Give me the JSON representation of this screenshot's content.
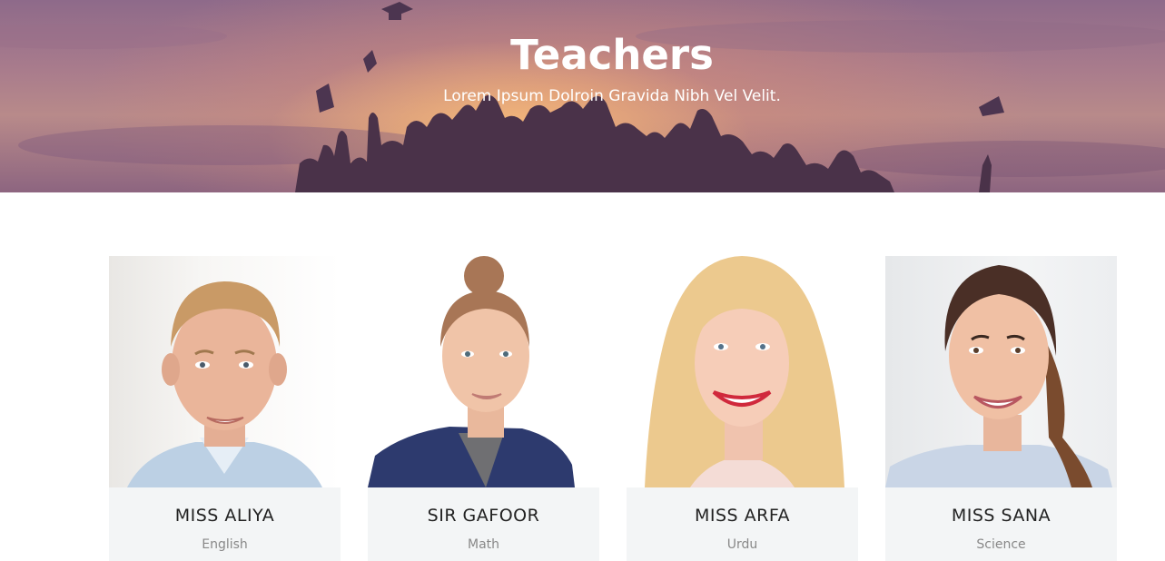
{
  "hero": {
    "title": "Teachers",
    "subtitle": "Lorem Ipsum Dolroin Gravida Nibh Vel Velit."
  },
  "teachers": [
    {
      "name": "MISS ALIYA",
      "subject": "English",
      "photo": "man-portrait"
    },
    {
      "name": "SIR GAFOOR",
      "subject": "Math",
      "photo": "woman-bun-portrait"
    },
    {
      "name": "MISS ARFA",
      "subject": "Urdu",
      "photo": "blonde-woman-portrait"
    },
    {
      "name": "MISS SANA",
      "subject": "Science",
      "photo": "woman-ponytail-portrait"
    }
  ],
  "colors": {
    "card_info_bg": "#f3f5f6",
    "name_text": "#222222",
    "subject_text": "#888888"
  }
}
